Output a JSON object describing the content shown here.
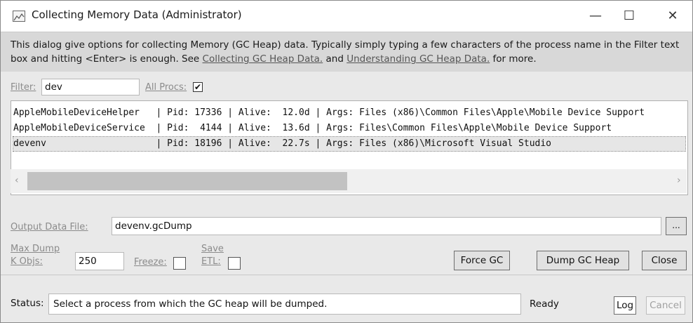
{
  "window": {
    "title": "Collecting Memory Data (Administrator)",
    "minimize": "—",
    "maximize": "☐",
    "close": "✕"
  },
  "description": {
    "text_before": "This dialog give options for collecting Memory (GC Heap) data. Typically simply typing a few characters of the process name in the Filter text box and hitting <Enter> is enough. See ",
    "link1": "Collecting GC Heap Data.",
    "text_between": " and ",
    "link2": "Understanding GC Heap Data.",
    "text_after": " for more."
  },
  "filter": {
    "label": "Filter:",
    "value": "dev",
    "all_procs_label": "All Procs:",
    "all_procs_checked": "✔"
  },
  "process_list": [
    "AppleMobileDeviceHelper   | Pid: 17336 | Alive:  12.0d | Args: Files (x86)\\Common Files\\Apple\\Mobile Device Support",
    "AppleMobileDeviceService  | Pid:  4144 | Alive:  13.6d | Args: Files\\Common Files\\Apple\\Mobile Device Support",
    "devenv                    | Pid: 18196 | Alive:  22.7s | Args: Files (x86)\\Microsoft Visual Studio"
  ],
  "scrollbar": {
    "left_arrow": "‹",
    "right_arrow": "›"
  },
  "output": {
    "label": "Output Data File:",
    "value": "devenv.gcDump",
    "browse": "..."
  },
  "options": {
    "max_dump_label_line1": "Max Dump",
    "max_dump_label_line2": "K Objs:",
    "max_dump_value": "250",
    "freeze_label": "Freeze:",
    "save_etl_line1": "Save",
    "save_etl_line2": "ETL:"
  },
  "buttons": {
    "force_gc": "Force GC",
    "dump_gc_heap": "Dump GC Heap",
    "close": "Close"
  },
  "status": {
    "label": "Status:",
    "text": "Select a process from which the GC heap will be dumped.",
    "ready": "Ready",
    "log": "Log",
    "cancel": "Cancel"
  }
}
